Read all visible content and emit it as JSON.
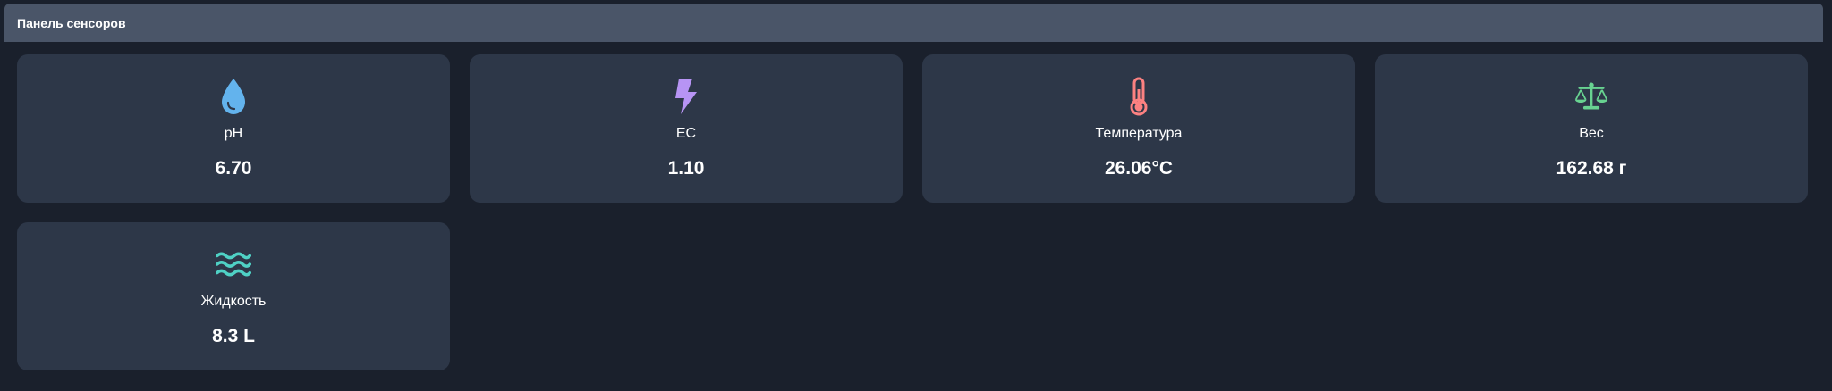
{
  "panel": {
    "title": "Панель сенсоров"
  },
  "sensors": [
    {
      "label": "pH",
      "value": "6.70",
      "icon": "droplet-icon",
      "color": "#63b3ed"
    },
    {
      "label": "EC",
      "value": "1.10",
      "icon": "bolt-icon",
      "color": "#b794f4"
    },
    {
      "label": "Температура",
      "value": "26.06°C",
      "icon": "thermometer-icon",
      "color": "#fc8181"
    },
    {
      "label": "Вес",
      "value": "162.68 г",
      "icon": "scale-icon",
      "color": "#68d391"
    },
    {
      "label": "Жидкость",
      "value": "8.3 L",
      "icon": "water-waves-icon",
      "color": "#4fd1c5"
    }
  ]
}
